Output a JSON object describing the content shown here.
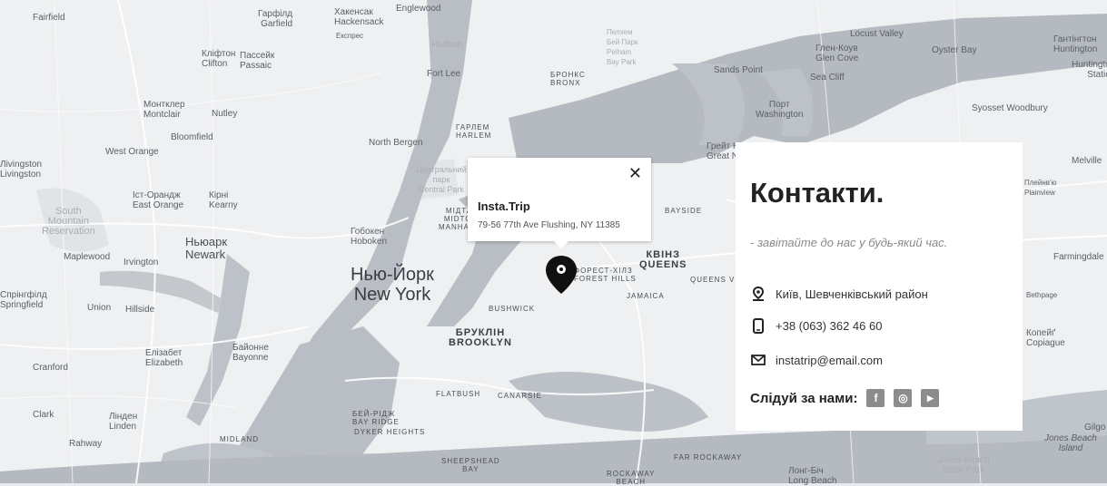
{
  "map": {
    "labels": {
      "fairfield": "Fairfield",
      "garfield": "Гарфілд\nGarfield",
      "hackensack": "Хакенсак\nHackensack",
      "englewood": "Englewood",
      "clifton": "Кліфтон\nClifton",
      "passaic": "Пассейк\nPassaic",
      "express": "Експрес",
      "hudson": "Hudson",
      "fort_lee": "Fort Lee",
      "bronx": "БРОНКС\nBRONX",
      "pelham": "Пелхем\nБей Парк\nPelham\nBay Park",
      "locust_valley": "Locust Valley",
      "glen_cove": "Глен-Коув\nGlen Cove",
      "oyster_bay": "Oyster Bay",
      "huntington": "Гантінгтон\nHuntington",
      "huntington_station": "Huntington\nStation",
      "sands_point": "Sands Point",
      "sea_cliff": "Sea Cliff",
      "port_washington": "Порт\nWashington",
      "syosset_woodbury": "Syosset Woodbury",
      "montclair": "Монтклер\nMontclair",
      "nutley": "Nutley",
      "bloomfield": "Bloomfield",
      "west_orange": "West Orange",
      "livingston": "Ліvіngston\nLivingston",
      "north_bergen": "North Bergen",
      "harlem": "ГАРЛЕМ\nHARLEM",
      "great_neck": "Грейт Нек\nGreat Neck",
      "melville": "Melville",
      "central_park": "Центральний\nпарк\nCentral Park",
      "east_orange": "Іст-Орандж\nEast Orange",
      "kearny": "Кірні\nKearny",
      "plainview": "Плейнв'ю\nPlainview",
      "south_mountain": "South\nMountain\nReservation",
      "midtown": "МІДТАУН\nMIDTOWN\nMANHATTAN",
      "hoboken": "Гобокен\nHoboken",
      "bayside": "BAYSIDE",
      "newark": "Ньюарк\nNewark",
      "maplewood": "Maplewood",
      "irvington": "Irvington",
      "farmingdale": "Farmingdale",
      "queens": "КВІНЗ\nQUEENS",
      "forest_hills": "ФОРЕСТ-ХІЛЗ\nFOREST HILLS",
      "queens_village": "QUEENS VILL",
      "new_york": "Нью-Йорк\nNew York",
      "springfield": "Спрінгфілд\nSpringfield",
      "union": "Union",
      "hillside": "Hillside",
      "bushwick": "BUSHWICK",
      "jamaica": "JAMAICA",
      "brooklyn": "БРУКЛІН\nBROOKLYN",
      "elizabeth": "Елізабет\nElizabeth",
      "bayonne": "Байонне\nBayonne",
      "cranford": "Cranford",
      "bethpage": "Bethpage",
      "copiague": "Копейґ\nCopiague",
      "clark": "Clark",
      "linden": "Лінден\nLinden",
      "rahway": "Rahway",
      "flatbush": "FLATBUSH",
      "canarsie": "CANARSIE",
      "bay_ridge": "БЕЙ-РІДЖ\nBAY RIDGE",
      "dyker": "DYKER HEIGHTS",
      "midland": "MIDLAND",
      "sheepshead": "SHEEPSHEAD\nBAY",
      "far_rockaway": "FAR ROCKAWAY",
      "rockaway": "ROCKAWAY\nBEACH",
      "long_beach": "Лонг-Біч\nLong Beach",
      "jones_beach": "Jones Beach\nIsland",
      "jones_state": "Jones Beach\nState Park",
      "gilgo": "Gilgo"
    }
  },
  "popup": {
    "close": "✕",
    "title": "Insta.Trip",
    "address": "79-56 77th Ave Flushing, NY 11385"
  },
  "contacts": {
    "title": "Контакти.",
    "subtitle": "- завітайте до нас у будь-який час.",
    "location": "Київ, Шевченківський район",
    "phone": "+38 (063) 362 46 60",
    "email": "instatrip@email.com",
    "follow": "Слідуй за нами:",
    "social": {
      "facebook": "f",
      "instagram": "◎",
      "youtube": "▶"
    }
  },
  "colors": {
    "land": "#eef0f2",
    "water": "#b7bcc2",
    "park": "#dfe2e5",
    "pin": "#111111",
    "social_bg": "#8c8c8c"
  }
}
